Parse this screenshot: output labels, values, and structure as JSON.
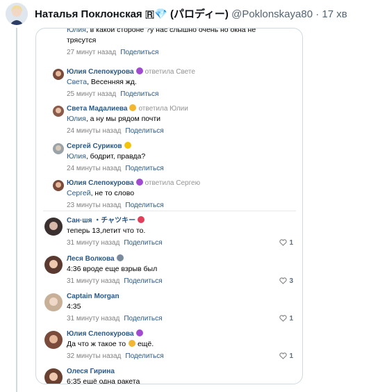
{
  "tweet": {
    "author": "Наталья Поклонская 🇷",
    "gem_icon": "gem-icon",
    "suffix": "(パロディー)",
    "handle": "@Poklonskaya80 · 17 хв"
  },
  "comments": [
    {
      "kind": "reply",
      "name": "",
      "emoji": "",
      "replied": "",
      "addressee": "Юлия",
      "text": ", в какой стороне ?у нас слышно очень но окна не",
      "text2": "трясутся",
      "time": "27 минут назад",
      "share": "Поделиться",
      "likes": ""
    },
    {
      "kind": "reply",
      "name": "Юлия Слепокурова",
      "emoji": "#a04bd0",
      "replied": "ответила Свете",
      "addressee": "Света",
      "text": ", Весенняя жд.",
      "text2": "",
      "time": "25 минут назад",
      "share": "Поделиться",
      "likes": ""
    },
    {
      "kind": "reply",
      "name": "Света Мадалиева",
      "emoji": "#f2b632",
      "replied": "ответила Юлии",
      "addressee": "Юлия",
      "text": ", а ну мы рядом почти",
      "text2": "",
      "time": "24 минуты назад",
      "share": "Поделиться",
      "likes": ""
    },
    {
      "kind": "reply",
      "name": "Сергей Суриков",
      "emoji": "#f2c40d",
      "replied": "",
      "addressee": "Юлия",
      "text": ", бодрит, правда?",
      "text2": "",
      "time": "24 минуты назад",
      "share": "Поделиться",
      "likes": ""
    },
    {
      "kind": "reply",
      "name": "Юлия Слепокурова",
      "emoji": "#a04bd0",
      "replied": "ответила Сергею",
      "addressee": "Сергей",
      "text": ", не то слово",
      "text2": "",
      "time": "23 минуты назад",
      "share": "Поделиться",
      "likes": ""
    },
    {
      "kind": "comment",
      "name": "Сан·шя ・チャツキー",
      "emoji": "#e0405a",
      "replied": "",
      "addressee": "",
      "text": "теперь 13,летит что то.",
      "text2": "",
      "time": "31 минуту назад",
      "share": "Поделиться",
      "likes": "1"
    },
    {
      "kind": "comment",
      "name": "Леся Волкова",
      "emoji": "#7a8aa0",
      "replied": "",
      "addressee": "",
      "text": "4:36 вроде еще взрыв был",
      "text2": "",
      "time": "31 минуту назад",
      "share": "Поделиться",
      "likes": "3"
    },
    {
      "kind": "comment",
      "name": "Captain Morgan",
      "emoji": "",
      "replied": "",
      "addressee": "",
      "text": "4:35",
      "text2": "",
      "time": "31 минуту назад",
      "share": "Поделиться",
      "likes": "1"
    },
    {
      "kind": "comment",
      "name": "Юлия Слепокурова",
      "emoji": "#a04bd0",
      "replied": "",
      "addressee": "",
      "text": "Да что ж такое то",
      "text2": "ещё.",
      "time": "32 минуты назад",
      "share": "Поделиться",
      "likes": "1"
    },
    {
      "kind": "comment",
      "name": "Олеся Гирина",
      "emoji": "",
      "replied": "",
      "addressee": "",
      "text": "6:35 ещё одна ракета",
      "text2": "",
      "time": "",
      "share": "",
      "likes": ""
    }
  ]
}
